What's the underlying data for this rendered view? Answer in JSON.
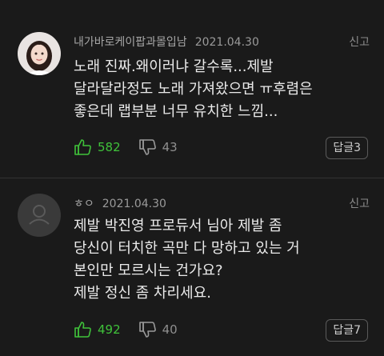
{
  "comments": [
    {
      "nickname": "내가바로케이팝과몰입남",
      "date": "2021.04.30",
      "report_label": "신고",
      "lines": [
        "노래 진짜.왜이러냐 갈수록...제발",
        "달라달라정도 노래 가져왔으면 ㅠ후렴은",
        "좋은데 랩부분 너무 유치한 느낌..."
      ],
      "likes": "582",
      "dislikes": "43",
      "reply_label": "답글3"
    },
    {
      "nickname": "ㅎㅇ",
      "date": "2021.04.30",
      "report_label": "신고",
      "lines": [
        "제발 박진영 프로듀서 님아 제발 좀",
        "당신이 터치한 곡만 다 망하고 있는 거",
        "본인만 모르시는 건가요?",
        "제발 정신 좀 차리세요."
      ],
      "likes": "492",
      "dislikes": "40",
      "reply_label": "답글7"
    }
  ],
  "colors": {
    "background": "#1a1a1a",
    "like": "#3fc23a",
    "text": "#eaeaea",
    "meta": "#9a9a9a"
  },
  "icons": {
    "like": "thumbs-up-icon",
    "dislike": "thumbs-down-icon",
    "default_avatar": "default-avatar-icon"
  }
}
